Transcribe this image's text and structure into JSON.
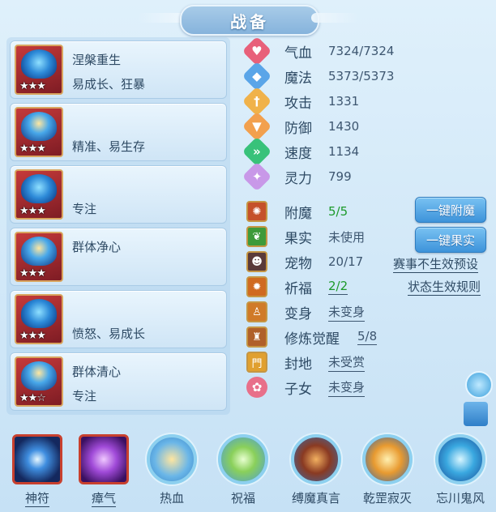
{
  "title": "战备",
  "pets": [
    {
      "line1": "涅槃重生",
      "line2": "易成长、狂暴",
      "stars": "★★★"
    },
    {
      "line1": "",
      "line2": "精准、易生存",
      "stars": "★★★"
    },
    {
      "line1": "",
      "line2": "专注",
      "stars": "★★★"
    },
    {
      "line1": "群体净心",
      "line2": "",
      "stars": "★★★"
    },
    {
      "line1": "",
      "line2": "愤怒、易成长",
      "stars": "★★★"
    },
    {
      "line1": "群体清心",
      "line2": "专注",
      "stars": "★★☆"
    }
  ],
  "stats": [
    {
      "label": "气血",
      "value": "7324/7324",
      "icon": "heart-icon",
      "color": "#e8607a"
    },
    {
      "label": "魔法",
      "value": "5373/5373",
      "icon": "mana-icon",
      "color": "#5aa5e8"
    },
    {
      "label": "攻击",
      "value": "1331",
      "icon": "attack-icon",
      "color": "#f0b24a"
    },
    {
      "label": "防御",
      "value": "1430",
      "icon": "defense-icon",
      "color": "#f2a04e"
    },
    {
      "label": "速度",
      "value": "1134",
      "icon": "speed-icon",
      "color": "#38c27a"
    },
    {
      "label": "灵力",
      "value": "799",
      "icon": "spirit-icon",
      "color": "#c898e8"
    }
  ],
  "extras": [
    {
      "label": "附魔",
      "value": "5/5",
      "icon": "enchant-icon",
      "green": true
    },
    {
      "label": "果实",
      "value": "未使用",
      "icon": "fruit-icon"
    },
    {
      "label": "宠物",
      "value": "20/17",
      "icon": "pet-portrait-icon"
    },
    {
      "label": "祈福",
      "value": "2/2",
      "icon": "blessing-icon",
      "green": true,
      "underline": true
    },
    {
      "label": "变身",
      "value": "未变身",
      "icon": "transform-icon",
      "underline": true
    },
    {
      "label": "修炼觉醒",
      "value": "5/8",
      "icon": "cultivation-icon",
      "underline": true
    },
    {
      "label": "封地",
      "value": "未受赏",
      "icon": "fief-icon",
      "underline": true
    },
    {
      "label": "子女",
      "value": "未变身",
      "icon": "child-icon",
      "underline": true
    }
  ],
  "buttons": {
    "enchant": "一键附魔",
    "fruit": "一键果实"
  },
  "links": {
    "preset": "赛事不生效预设",
    "rules": "状态生效规则"
  },
  "skills": [
    {
      "label": "神符",
      "icon": "rune-icon"
    },
    {
      "label": "瘴气",
      "icon": "miasma-icon"
    },
    {
      "label": "热血",
      "icon": "hot-blood-icon"
    },
    {
      "label": "祝福",
      "icon": "blessing-orb-icon"
    },
    {
      "label": "缚魔真言",
      "icon": "bind-demon-icon"
    },
    {
      "label": "乾罡寂灭",
      "icon": "qiangang-icon"
    },
    {
      "label": "忘川鬼风",
      "icon": "ghost-wind-icon"
    }
  ]
}
